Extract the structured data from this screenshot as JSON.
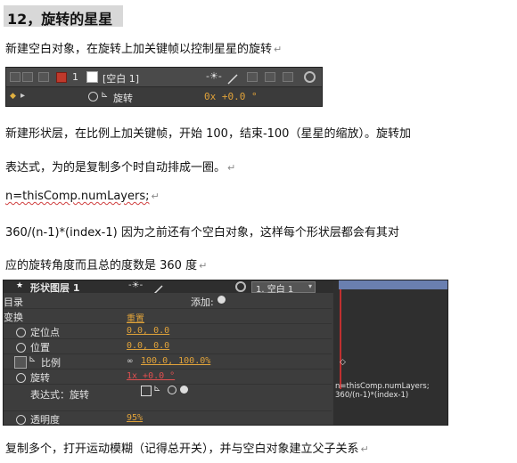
{
  "heading": "12，旋转的星星",
  "p1": "新建空白对象，在旋转上加关键帧以控制星星的旋转",
  "panel1": {
    "layer_number": "1",
    "layer_name": "[空白 1]",
    "prop_name": "旋转",
    "prop_value": "0x +0.0 °"
  },
  "p2_line1": "新建形状层，在比例上加关键帧，开始 100，结束-100（星星的缩放）。旋转加",
  "p2_line2": "表达式，为的是复制多个时自动排成一圈。",
  "code1": "n=thisComp.numLayers;",
  "p3_line1": "360/(n-1)*(index-1)    因为之前还有个空白对象，这样每个形状层都会有其对",
  "p3_line2": "应的旋转角度而且总的度数是 360 度",
  "panel2": {
    "layer_name": "形状图层 1",
    "parent": "1. 空白 1",
    "contents": "目录",
    "add_label": "添加:",
    "transform": "变换",
    "reset": "重置",
    "anchor_label": "定位点",
    "anchor_value": "0.0, 0.0",
    "position_label": "位置",
    "position_value": "0.0, 0.0",
    "scale_label": "比例",
    "scale_value": "100.0, 100.0%",
    "rotation_label": "旋转",
    "rotation_value": "1x +0.0 °",
    "expression_label": "表达式：旋转",
    "expr_line1": "n=thisComp.numLayers;",
    "expr_line2": "360/(n-1)*(index-1)",
    "opacity_label": "透明度",
    "opacity_value": "95%"
  },
  "p4": "复制多个，打开运动模糊（记得总开关），并与空白对象建立父子关系"
}
